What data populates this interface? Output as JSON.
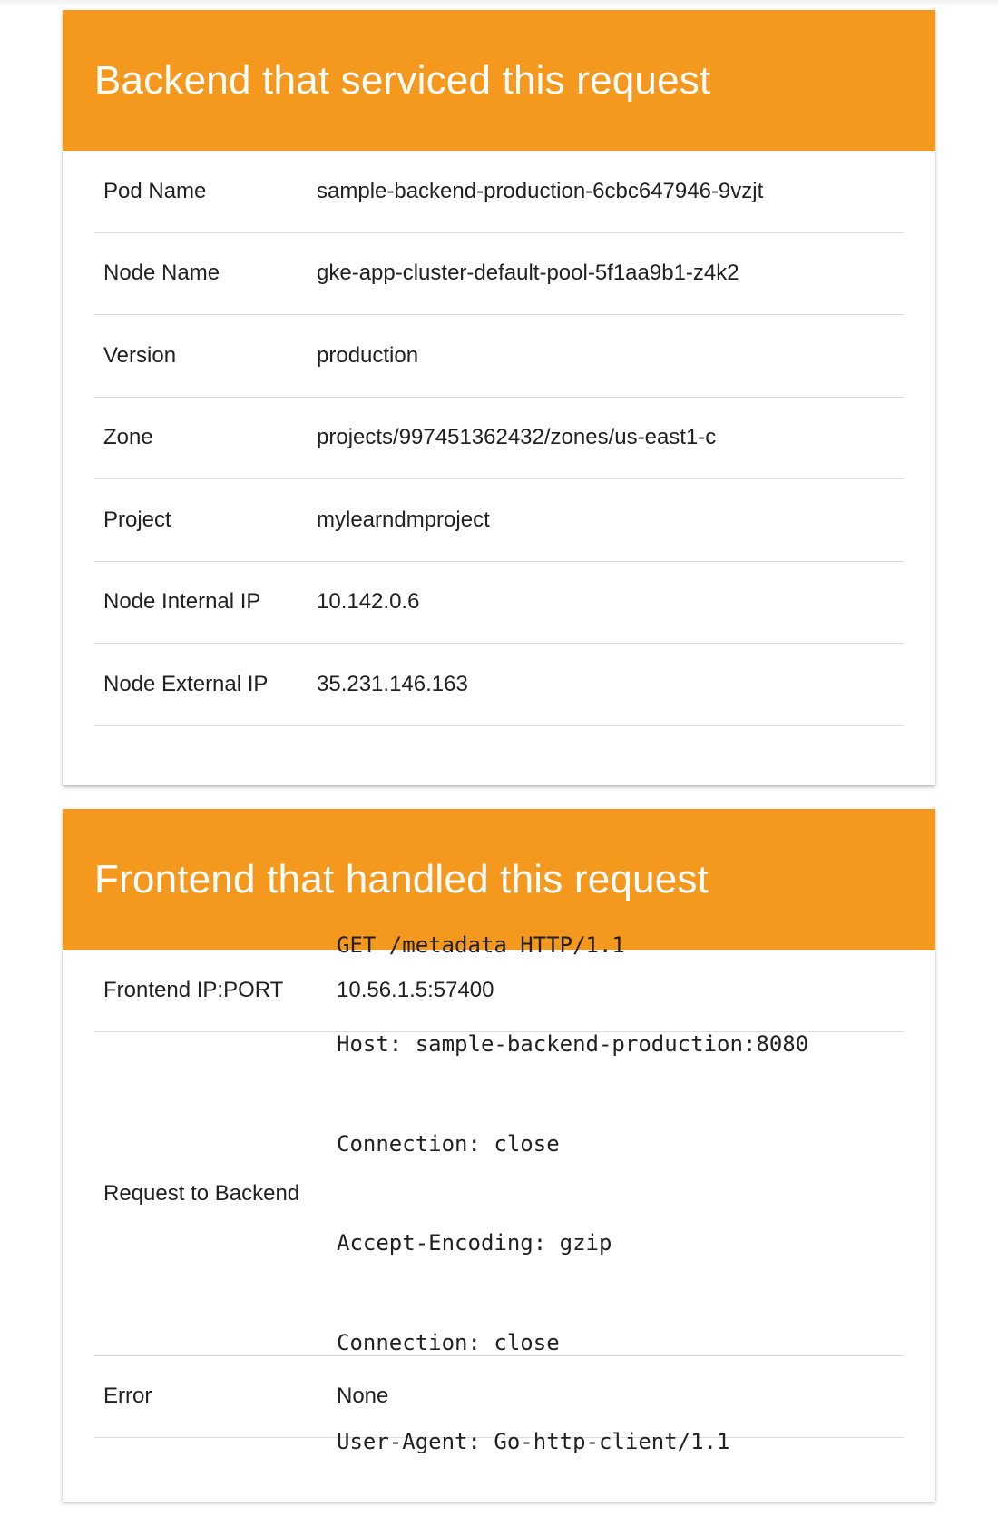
{
  "backend": {
    "title": "Backend that serviced this request",
    "rows": [
      {
        "label": "Pod Name",
        "value": "sample-backend-production-6cbc647946-9vzjt"
      },
      {
        "label": "Node Name",
        "value": "gke-app-cluster-default-pool-5f1aa9b1-z4k2"
      },
      {
        "label": "Version",
        "value": "production"
      },
      {
        "label": "Zone",
        "value": "projects/997451362432/zones/us-east1-c"
      },
      {
        "label": "Project",
        "value": "mylearndmproject"
      },
      {
        "label": "Node Internal IP",
        "value": "10.142.0.6"
      },
      {
        "label": "Node External IP",
        "value": "35.231.146.163"
      }
    ]
  },
  "frontend": {
    "title": "Frontend that handled this request",
    "ip_port": {
      "label": "Frontend IP:PORT",
      "value": "10.56.1.5:57400"
    },
    "request": {
      "label": "Request to Backend",
      "lines": [
        "GET /metadata HTTP/1.1",
        "Host: sample-backend-production:8080",
        "Connection: close",
        "Accept-Encoding: gzip",
        "Connection: close",
        "User-Agent: Go-http-client/1.1"
      ]
    },
    "error": {
      "label": "Error",
      "value": "None"
    }
  }
}
